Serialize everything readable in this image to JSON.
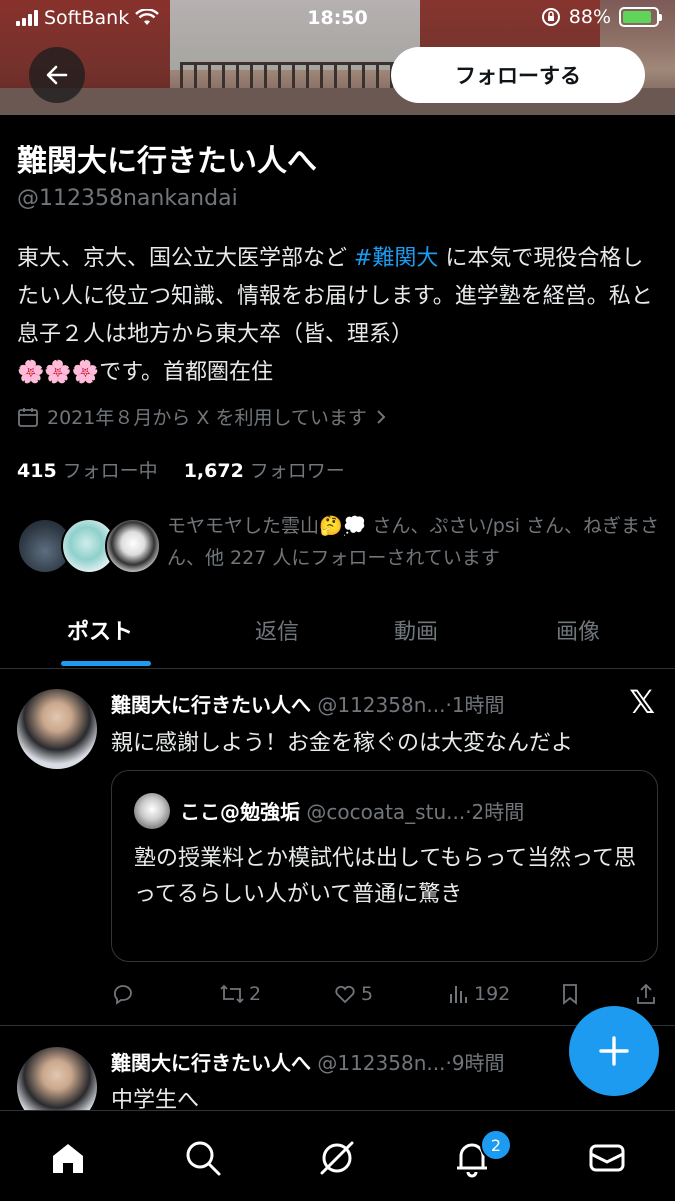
{
  "status_bar": {
    "carrier": "SoftBank",
    "time": "18:50",
    "battery": "88%"
  },
  "header": {
    "follow_label": "フォローする"
  },
  "profile": {
    "name": "難関大に行きたい人へ",
    "handle": "@112358nankandai",
    "bio_part1": "東大、京大、国公立大医学部など ",
    "bio_hashtag": "#難関大",
    "bio_part2": " に本気で現役合格したい人に役立つ知識、情報をお届けします。進学塾を経営。私と息子２人は地方から東大卒（皆、理系）",
    "bio_emoji": "🌸🌸🌸",
    "bio_part3": "です。首都圏在住",
    "joined": "2021年８月から X を利用しています",
    "following_count": "415",
    "following_label": "フォロー中",
    "followers_count": "1,672",
    "followers_label": "フォロワー",
    "followed_by_text": "モヤモヤした雲山🤔💭 さん、ぷさい/psi さん、ねぎまさん、他 227 人にフォローされています"
  },
  "tabs": [
    {
      "label": "ポスト",
      "active": true
    },
    {
      "label": "返信",
      "active": false
    },
    {
      "label": "動画",
      "active": false
    },
    {
      "label": "画像",
      "active": false
    }
  ],
  "tweets": [
    {
      "author": "難関大に行きたい人へ",
      "handle": "@112358n...",
      "time": "·1時間",
      "text": "親に感謝しよう！お金を稼ぐのは大変なんだよ",
      "quote": {
        "author": "ここ@勉強垢",
        "handle": "@cocoata_stu...",
        "time": "·2時間",
        "text": "塾の授業料とか模試代は出してもらって当然って思ってるらしい人がいて普通に驚き"
      },
      "retweets": "2",
      "likes": "5",
      "views": "192"
    },
    {
      "author": "難関大に行きたい人へ",
      "handle": "@112358n...",
      "time": "·9時間",
      "text": "中学生へ"
    }
  ],
  "navbar": {
    "notification_badge": "2"
  },
  "colors": {
    "accent": "#1d9bf0",
    "background": "#000000",
    "muted": "#71767b"
  }
}
